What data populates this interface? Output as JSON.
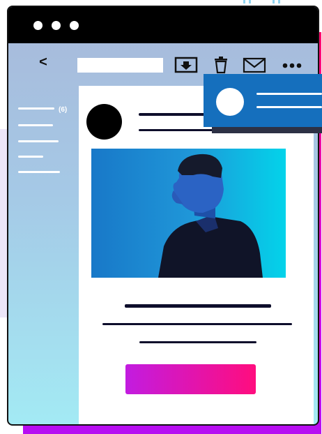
{
  "window": {
    "back_label": "<",
    "sidebar": {
      "count_label": "(6)"
    }
  },
  "colors": {
    "accent": "#ff0d7e",
    "notification": "#156fbd",
    "title_bar": "#000000"
  },
  "icons": [
    "download-icon",
    "trash-icon",
    "mail-icon",
    "more-icon"
  ]
}
